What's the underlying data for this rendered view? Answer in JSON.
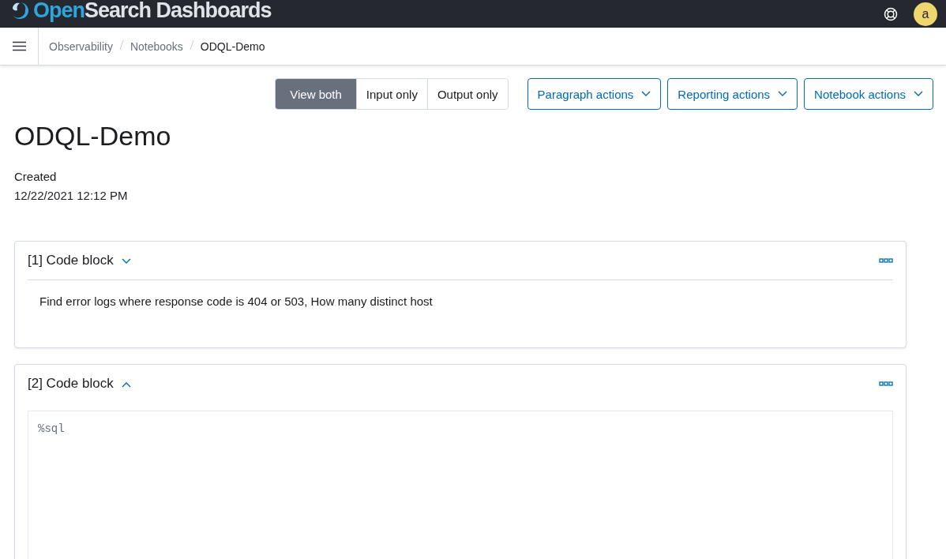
{
  "header": {
    "logo": {
      "part_1": "Open",
      "part_2": "Search Dashboards"
    },
    "avatar": "a"
  },
  "breadcrumbs": [
    {
      "label": "Observability",
      "current": false
    },
    {
      "label": "Notebooks",
      "current": false
    },
    {
      "label": "ODQL-Demo",
      "current": true
    }
  ],
  "view_toggle": [
    {
      "label": "View both",
      "selected": true
    },
    {
      "label": "Input only",
      "selected": false
    },
    {
      "label": "Output only",
      "selected": false
    }
  ],
  "action_menus": [
    "Paragraph actions",
    "Reporting actions",
    "Notebook actions"
  ],
  "notebook": {
    "title": "ODQL-Demo",
    "created_label": "Created",
    "created_date": "12/22/2021 12:12 PM"
  },
  "paragraphs": [
    {
      "title": "[1] Code block",
      "expanded": false,
      "kind": "output",
      "text": "Find error logs where response code is 404 or 503, How many distinct host"
    },
    {
      "title": "[2] Code block",
      "expanded": true,
      "kind": "input",
      "text": "%sql"
    }
  ]
}
